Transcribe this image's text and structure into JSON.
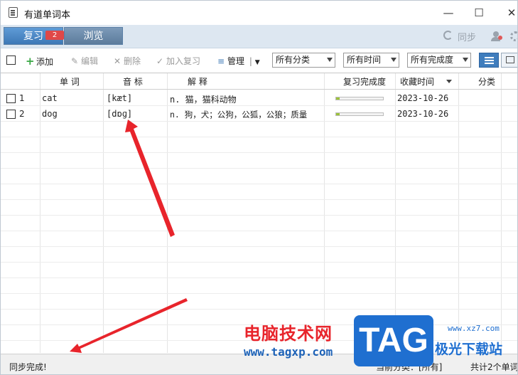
{
  "window": {
    "title": "有道单词本",
    "minimize": "—",
    "maximize": "☐",
    "close": "✕"
  },
  "tabs": {
    "review": {
      "label": "复习",
      "badge": "2"
    },
    "browse": {
      "label": "浏览"
    }
  },
  "topright": {
    "sync_label": "同步"
  },
  "toolbar": {
    "add": "添加",
    "edit": "编辑",
    "delete": "删除",
    "add_review": "加入复习",
    "manage": "管理",
    "category": "所有分类",
    "time": "所有时间",
    "completion": "所有完成度"
  },
  "table": {
    "headers": {
      "word": "单 词",
      "phonetic": "音 标",
      "definition": "解 释",
      "progress": "复习完成度",
      "date": "收藏时间",
      "category": "分类"
    },
    "rows": [
      {
        "num": "1",
        "word": "cat",
        "phonetic": "[kæt]",
        "definition": "n. 猫，猫科动物",
        "progress": 0.08,
        "date": "2023-10-26",
        "category": ""
      },
      {
        "num": "2",
        "word": "dog",
        "phonetic": "[dɒɡ]",
        "definition": "n. 狗，犬；公狗，公狐，公狼；质量",
        "progress": 0.08,
        "date": "2023-10-26",
        "category": ""
      }
    ]
  },
  "status": {
    "left": "同步完成!",
    "category": "当前分类：[所有]",
    "count": "共计2个单词"
  },
  "watermark": {
    "cn": "电脑技术网",
    "url": "www.tagxp.com",
    "logo": "TAG",
    "sub": "极光下载站",
    "sub_url": "www.xz7.com"
  },
  "colors": {
    "accent": "#3d78b6",
    "progress_fill": "#9cc23a",
    "annotation_arrow": "#e8242b"
  }
}
